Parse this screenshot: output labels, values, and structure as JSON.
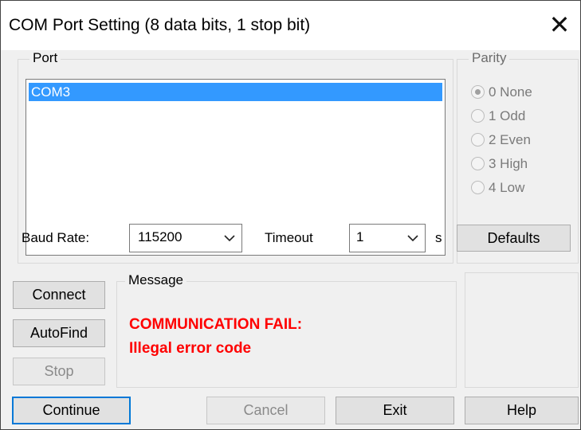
{
  "window": {
    "title": "COM Port Setting (8 data bits, 1 stop bit)",
    "close_glyph": "✕"
  },
  "port": {
    "label": "Port",
    "items": [
      "COM3"
    ],
    "selected": "COM3"
  },
  "parity": {
    "label": "Parity",
    "options": [
      {
        "label": "0 None",
        "checked": true
      },
      {
        "label": "1 Odd",
        "checked": false
      },
      {
        "label": "2 Even",
        "checked": false
      },
      {
        "label": "3 High",
        "checked": false
      },
      {
        "label": "4 Low",
        "checked": false
      }
    ]
  },
  "settings": {
    "baud_label": "Baud Rate:",
    "baud_value": "115200",
    "timeout_label": "Timeout",
    "timeout_value": "1",
    "timeout_unit": "s",
    "defaults_label": "Defaults"
  },
  "actions": {
    "connect_label": "Connect",
    "autofind_label": "AutoFind",
    "stop_label": "Stop"
  },
  "message": {
    "label": "Message",
    "line1": "COMMUNICATION FAIL:",
    "line2": "Illegal error code",
    "color": "#ff0000"
  },
  "footer": {
    "continue_label": "Continue",
    "cancel_label": "Cancel",
    "exit_label": "Exit",
    "help_label": "Help"
  },
  "icons": {
    "close": "close-icon",
    "dropdown": "chevron-down-icon"
  },
  "colors": {
    "selection": "#3399ff",
    "default_button_border": "#0078d7"
  }
}
